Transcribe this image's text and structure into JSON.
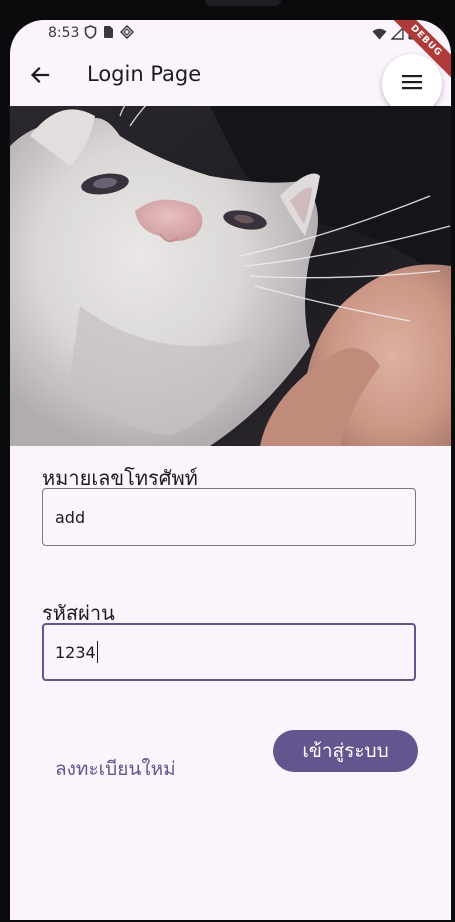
{
  "status_bar": {
    "time": "8:53",
    "left_icons": [
      "shield-icon",
      "sim-card-icon",
      "app-diamond-icon"
    ],
    "right_icons": [
      "wifi-icon",
      "signal-icon",
      "battery-icon"
    ],
    "debug_banner": "DEBUG"
  },
  "app_bar": {
    "title": "Login Page",
    "back_icon": "arrow-back-icon",
    "menu_icon": "menu-icon"
  },
  "hero": {
    "description_icon": "cat-photo"
  },
  "form": {
    "phone": {
      "label": "หมายเลขโทรศัพท์",
      "value": "add"
    },
    "password": {
      "label": "รหัสผ่าน",
      "value": "1234"
    },
    "register_label": "ลงทะเบียนใหม่",
    "login_label": "เข้าสู่ระบบ"
  },
  "colors": {
    "background": "#fcf4fc",
    "accent": "#65558f",
    "text": "#1d1b20",
    "debug_ribbon": "#b03a3a"
  }
}
